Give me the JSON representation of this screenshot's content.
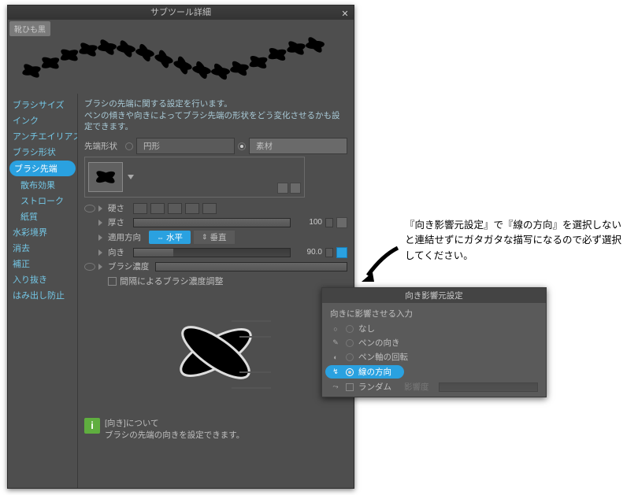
{
  "window": {
    "title": "サブツール詳細"
  },
  "preview_tag": "靴ひも黒",
  "sidebar": {
    "items": [
      {
        "label": "ブラシサイズ"
      },
      {
        "label": "インク"
      },
      {
        "label": "アンチエイリアス"
      },
      {
        "label": "ブラシ形状"
      },
      {
        "label": "ブラシ先端",
        "active": true
      },
      {
        "label": "散布効果",
        "sub": true
      },
      {
        "label": "ストローク",
        "sub": true
      },
      {
        "label": "紙質",
        "sub": true
      },
      {
        "label": "水彩境界"
      },
      {
        "label": "消去"
      },
      {
        "label": "補正"
      },
      {
        "label": "入り抜き"
      },
      {
        "label": "はみ出し防止"
      }
    ]
  },
  "main": {
    "description": "ブラシの先端に関する設定を行います。\nペンの傾きや向きによってブラシ先端の形状をどう変化させるかも設定できます。",
    "tip_shape_label": "先端形状",
    "circle_label": "円形",
    "material_label": "素材",
    "hardness_label": "硬さ",
    "thickness_label": "厚さ",
    "thickness_value": "100",
    "apply_dir_label": "適用方向",
    "horizontal_label": "水平",
    "vertical_label": "垂直",
    "direction_label": "向き",
    "direction_value": "90.0",
    "brush_density_label": "ブラシ濃度",
    "gap_adjust_label": "間隔によるブラシ濃度調整"
  },
  "info": {
    "title": "[向き]について",
    "text": "ブラシの先端の向きを設定できます。"
  },
  "popup": {
    "title": "向き影響元設定",
    "heading": "向きに影響させる入力",
    "options": [
      {
        "icon": "○",
        "label": "なし"
      },
      {
        "icon": "✎",
        "label": "ペンの向き"
      },
      {
        "icon": "◐",
        "label": "ペン軸の回転"
      },
      {
        "icon": "↯",
        "label": "線の方向",
        "active": true
      },
      {
        "icon": "⤳",
        "label": "ランダム",
        "checkbox": true
      }
    ],
    "influence_label": "影響度"
  },
  "annotation": "『向き影響元設定』で『線の方向』を選択しないと連結せずにガタガタな描写になるので必ず選択してください。"
}
